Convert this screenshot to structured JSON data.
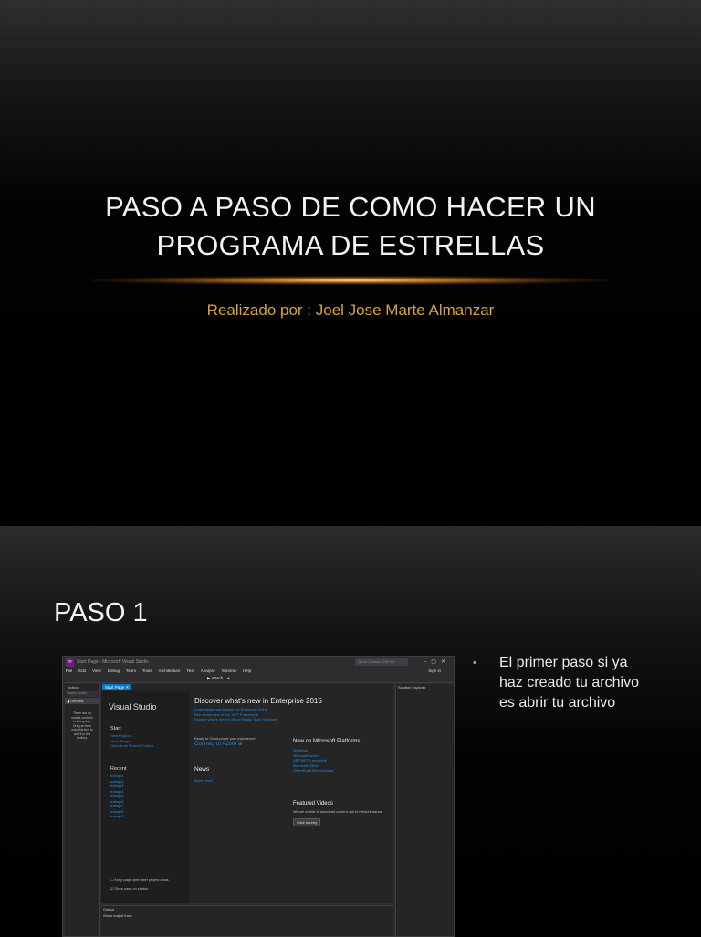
{
  "slide1": {
    "title_line1": "PASO A PASO DE COMO HACER UN",
    "title_line2": "PROGRAMA DE ESTRELLAS",
    "subtitle": "Realizado por : Joel Jose Marte Almanzar"
  },
  "slide2": {
    "title": "PASO 1",
    "bullet": "El primer paso si ya haz creado tu archivo es abrir tu archivo"
  },
  "vs": {
    "window_title": "Start Page - Microsoft Visual Studio",
    "quick_launch": "Quick Launch (Ctrl+Q)",
    "menu": [
      "File",
      "Edit",
      "View",
      "Debug",
      "Team",
      "Tools",
      "Architecture",
      "Test",
      "Analyze",
      "Window",
      "Help"
    ],
    "sign_in": "Sign in",
    "attach": "▶ Attach... ▾",
    "toolbox": {
      "title": "Toolbox",
      "search": "Search Toolbo",
      "general": "◢ General",
      "message": "There are no usable controls in this group. Drag an item onto this text to add it to the toolbox."
    },
    "tab": "Start Page ✕",
    "brand": "Visual Studio",
    "start": {
      "heading": "Start",
      "links": [
        "New Project...",
        "Open Project...",
        "Open from Source Control..."
      ]
    },
    "recent": {
      "heading": "Recent",
      "items": [
        "trabajo1",
        "trabajo2",
        "trabajo3",
        "trabajo4",
        "trabajo5",
        "trabajo6",
        "trabajo7",
        "trabajo8",
        "trabajo9"
      ]
    },
    "discover": {
      "heading": "Discover what's new in Enterprise 2015",
      "links": [
        "Learn about new features in Enterprise 2015",
        "See what's new in the .NET Framework",
        "Explore what's new in Visual Studio Team Services"
      ]
    },
    "azure": {
      "ready": "Ready to Cloud-power your experience?",
      "connect": "Connect to Azure ⊕"
    },
    "news": {
      "heading": "News",
      "more": "More news"
    },
    "platforms": {
      "heading": "New on Microsoft Platforms",
      "items": [
        "Windows",
        "Microsoft Azure",
        "ASP.NET 5 and Web",
        "Microsoft Office",
        "SharePoint Development"
      ]
    },
    "videos": {
      "heading": "Featured Videos",
      "message": "We are unable to download content due to network issues.",
      "button": "Click to retry"
    },
    "options": {
      "keep_open": "Keep page open after project loads",
      "show_startup": "Show page on startup"
    },
    "solution_explorer": {
      "title": "Solution Explorer"
    },
    "output": {
      "title": "Output",
      "show_from": "Show output from:"
    }
  }
}
